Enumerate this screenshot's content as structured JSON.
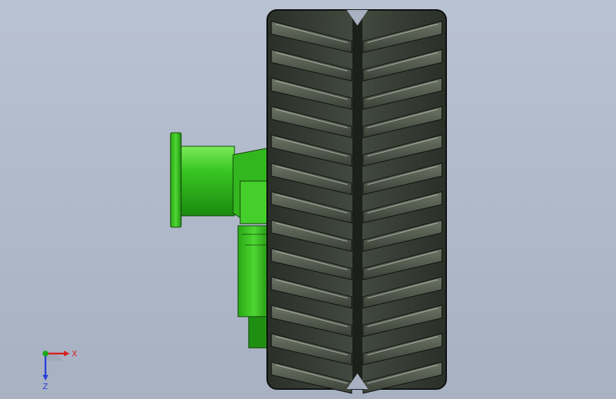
{
  "app": {
    "view": "cad-viewport"
  },
  "colors": {
    "background_top": "#b9c2d1",
    "background_bottom": "#a7b1c2",
    "tire_dark": "#2b3029",
    "tire_mid": "#4b5347",
    "tire_light": "#8a9183",
    "tire_edge": "#0c0e0c",
    "hub_green": "#2fbf1a",
    "hub_green_dark": "#1f8f12",
    "hub_green_light": "#6ee64f",
    "axis_x": "#d61f1f",
    "axis_y": "#1aa81a",
    "axis_z": "#2a3fd6"
  },
  "triad": {
    "x_label": "X",
    "y_label": "",
    "z_label": "Z"
  }
}
